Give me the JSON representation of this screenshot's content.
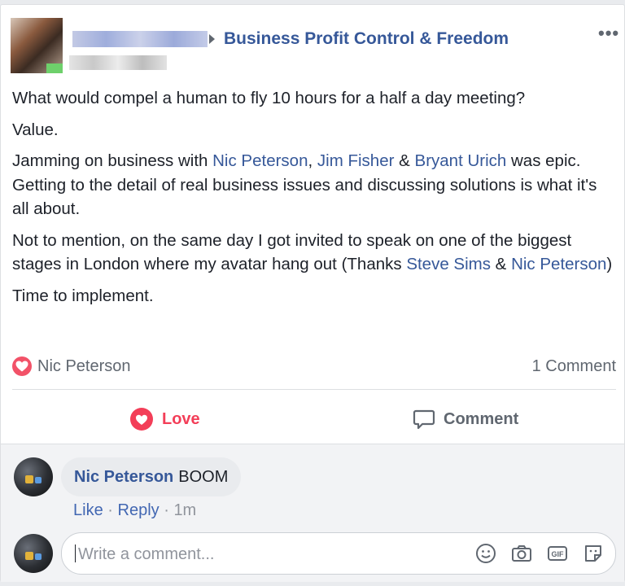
{
  "header": {
    "group_name": "Business Profit Control & Freedom",
    "more_label": "•••"
  },
  "post": {
    "para1": "What would compel a human to fly 10 hours for a half a day meeting?",
    "para2": "Value.",
    "para3": {
      "prefix": "Jamming on business with ",
      "mention1": "Nic Peterson",
      "sep1": ", ",
      "mention2": "Jim Fisher",
      "sep2": " & ",
      "mention3": "Bryant Urich",
      "suffix": " was epic. Getting to the detail of real business issues and discussing solutions is what it's all about."
    },
    "para4": {
      "prefix": "Not to mention, on the same day I got invited to speak on one of the biggest stages in London where my avatar hang out (Thanks ",
      "mention1": "Steve Sims",
      "sep": " & ",
      "mention2": "Nic Peterson",
      "suffix": ")"
    },
    "para5": "Time to implement."
  },
  "reactions": {
    "reactor": "Nic Peterson",
    "comment_count": "1 Comment",
    "love_color": "#f25268"
  },
  "actions": {
    "love_label": "Love",
    "comment_label": "Comment"
  },
  "comment": {
    "author": "Nic Peterson",
    "text": "BOOM",
    "like": "Like",
    "dot": "·",
    "reply": "Reply",
    "time": "1m"
  },
  "composer": {
    "placeholder": "Write a comment..."
  },
  "colors": {
    "link": "#365899",
    "love_active": "#f33e58"
  }
}
